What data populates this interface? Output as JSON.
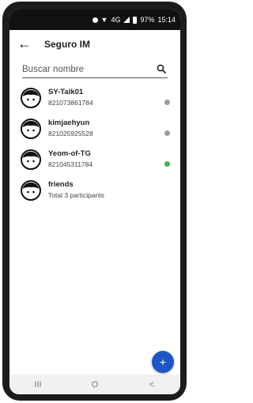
{
  "status_bar": {
    "network": "4G",
    "battery": "97%",
    "time": "15:14"
  },
  "app_bar": {
    "back_icon": "arrow-left-icon",
    "title": "Seguro IM"
  },
  "search": {
    "placeholder": "Buscar nombre",
    "value": "",
    "icon": "search-icon"
  },
  "contacts": [
    {
      "name": "SY-Talk01",
      "subtitle": "821073861784",
      "status": "offline",
      "status_color": "#9e9e9e"
    },
    {
      "name": "kimjaehyun",
      "subtitle": "821025925528",
      "status": "offline",
      "status_color": "#9e9e9e"
    },
    {
      "name": "Yeom-of-TG",
      "subtitle": "821045311784",
      "status": "online",
      "status_color": "#4caf50"
    },
    {
      "name": "friends",
      "subtitle": "Total 3 participants",
      "status": "",
      "status_color": ""
    }
  ],
  "fab": {
    "label": "+",
    "color": "#1e56c8"
  },
  "nav_bar": {
    "recents": "III",
    "home": "O",
    "back": "<"
  }
}
